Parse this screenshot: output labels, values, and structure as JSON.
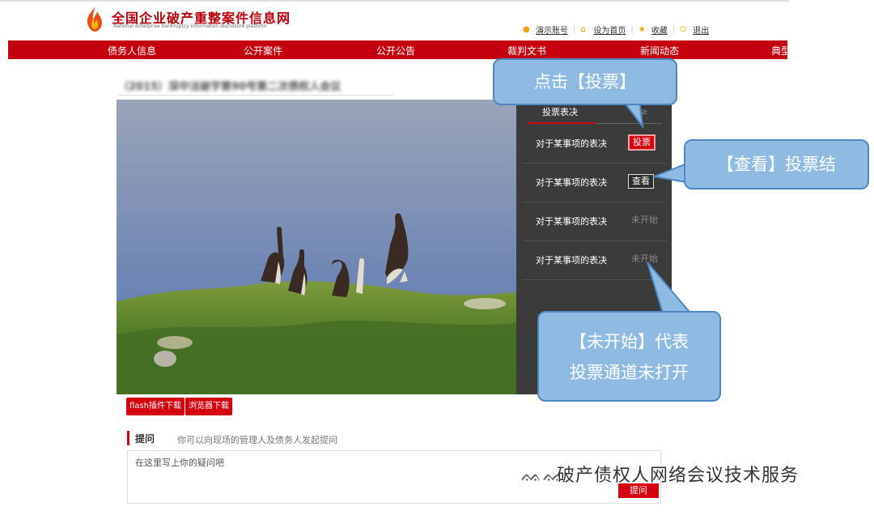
{
  "header": {
    "site_title": "全国企业破产重整案件信息网",
    "site_subtitle": "National enterprise bankruptcy information disclosure platform",
    "links": {
      "demo_account": "演示账号",
      "set_home": "设为首页",
      "favorite": "收藏",
      "logout": "退出"
    }
  },
  "nav": {
    "items": [
      "债务人信息",
      "公开案件",
      "公开公告",
      "裁判文书",
      "新闻动态",
      "典型"
    ]
  },
  "meeting": {
    "title": "（2015）深中法破字第90号第二次债权人会议"
  },
  "vote_panel": {
    "tab_label": "投票表决",
    "tab_fragment": "≥",
    "rows": [
      {
        "label": "对于某事项的表决",
        "action": "投票"
      },
      {
        "label": "对于某事项的表决",
        "action": "查看"
      },
      {
        "label": "对于某事项的表决",
        "action": "未开始"
      },
      {
        "label": "对于某事项的表决",
        "action": "未开始"
      }
    ]
  },
  "callouts": {
    "vote": "点击【投票】",
    "view": "【查看】投票结",
    "not_started_line1": "【未开始】代表",
    "not_started_line2": "投票通道未打开"
  },
  "downloads": {
    "flash": "flash插件下载",
    "browser": "浏览器下载"
  },
  "question": {
    "label": "提问",
    "hint": "你可以向现场的管理人及债务人发起提问",
    "placeholder": "在这里写上你的疑问吧",
    "submit": "提问"
  },
  "watermark": "破产债权人网络会议技术服务",
  "colors": {
    "brand_red": "#c4000f",
    "panel_dark": "#3b3b3b",
    "callout_fill": "#8fbbe3",
    "callout_border": "#4d87c4"
  }
}
